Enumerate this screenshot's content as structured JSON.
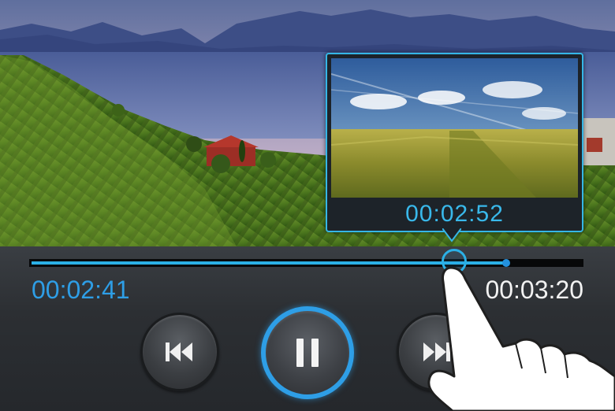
{
  "player": {
    "current_time": "00:02:41",
    "total_time": "00:03:20",
    "progress_fraction": 0.86,
    "preview": {
      "time": "00:02:52",
      "position_fraction": 0.765
    }
  },
  "controls": {
    "previous_icon": "skip-previous-icon",
    "play_pause_icon": "pause-icon",
    "next_icon": "skip-next-icon"
  },
  "colors": {
    "accent": "#2bb0e6",
    "current_time": "#2e9ee6",
    "total_time": "#f2f2f2",
    "panel": "#2c2f33"
  }
}
